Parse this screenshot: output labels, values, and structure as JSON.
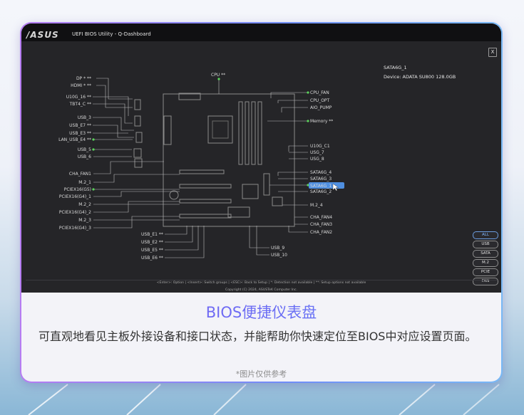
{
  "window": {
    "logo": "/ASUS",
    "title": "UEFI BIOS Utility - Q-Dashboard",
    "close_label": "X"
  },
  "device_panel": {
    "port": "SATA6G_1",
    "device_label": "Device:",
    "device_value": "ADATA SU800 128.0GB"
  },
  "board": {
    "top_label": "CPU **",
    "left_labels": [
      "DP * **",
      "HDMI * **",
      "U10G_16 **",
      "TBT4_C **",
      "USB_3",
      "USB_E7 **",
      "USB_E3 **",
      "LAN_USB_E4 **",
      "USB_5",
      "USB_6",
      "CHA_FAN1",
      "M.2_1",
      "PCIEX16(G5)",
      "PCIEX16(G4)_1",
      "M.2_2",
      "PCIEX16(G4)_2",
      "M.2_3",
      "PCIEX16(G4)_3"
    ],
    "bottom_left_labels": [
      "USB_E1 **",
      "USB_E2 **",
      "USB_E5 **",
      "USB_E6 **"
    ],
    "bottom_labels": [
      "USB_9",
      "USB_10"
    ],
    "right_labels": [
      "CPU_FAN",
      "CPU_OPT",
      "AIO_PUMP",
      "Memory **",
      "U10G_C1",
      "USG_7",
      "USG_8",
      "SATA6G_4",
      "SATA6G_3",
      "SATA6G_1",
      "SATA6G_2",
      "M.2_4",
      "CHA_FAN4",
      "CHA_FAN3",
      "CHA_FAN2"
    ],
    "highlighted": "SATA6G_1"
  },
  "filters": [
    "ALL",
    "USB",
    "SATA",
    "M.2",
    "PCIE",
    "FAN"
  ],
  "active_filter": "ALL",
  "footer": {
    "help": "<Enter>: Option  |  <Insert>: Switch groups  |  <ESC>: Back to Setup  |  *: Detection not available  |  **: Setup options not available",
    "copyright": "Copyright (C) 2024, ASUSTeK Computer Inc."
  },
  "caption": {
    "headline": "BIOS便捷仪表盘",
    "description": "可直观地看见主板外接设备和接口状态，并能帮助你快速定位至BIOS中对应设置页面。",
    "note": "*图片仅供参考"
  },
  "colors": {
    "accent_purple": "#7c5cf1",
    "highlight_blue": "#4f8fe0",
    "connector_green": "#5bd35b",
    "bios_bg": "#252528"
  }
}
